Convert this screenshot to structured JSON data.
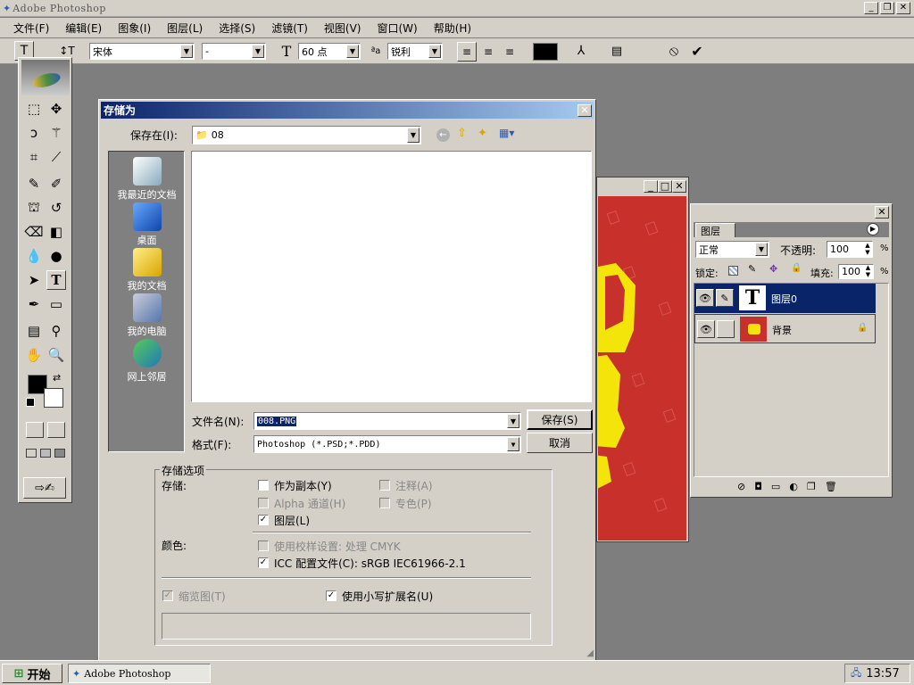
{
  "app": {
    "title": "Adobe Photoshop"
  },
  "menubar": [
    "文件(F)",
    "编辑(E)",
    "图象(I)",
    "图层(L)",
    "选择(S)",
    "滤镜(T)",
    "视图(V)",
    "窗口(W)",
    "帮助(H)"
  ],
  "options": {
    "font_family": "宋体",
    "font_style": "-",
    "font_size": "60 点",
    "antialias": "锐利",
    "color": "#000000"
  },
  "dialog": {
    "title": "存储为",
    "save_in_label": "保存在(I):",
    "save_in_value": "08",
    "places": [
      "我最近的文档",
      "桌面",
      "我的文档",
      "我的电脑",
      "网上邻居"
    ],
    "filename_label": "文件名(N):",
    "filename_value": "008.PNG",
    "format_label": "格式(F):",
    "format_value": "Photoshop (*.PSD;*.PDD)",
    "save_button": "保存(S)",
    "cancel_button": "取消",
    "options_group": "存储选项",
    "save_label": "存储:",
    "as_copy": "作为副本(Y)",
    "annotations": "注释(A)",
    "alpha": "Alpha 通道(H)",
    "spot": "专色(P)",
    "layers": "图层(L)",
    "color_label": "颜色:",
    "proof": "使用校样设置: 处理 CMYK",
    "icc": "ICC 配置文件(C): sRGB IEC61966-2.1",
    "thumbnail": "缩览图(T)",
    "lowercase": "使用小写扩展名(U)"
  },
  "layers_panel": {
    "tab": "图层",
    "blend_mode": "正常",
    "opacity_label": "不透明:",
    "opacity_value": "100",
    "percent": "%",
    "lock_label": "锁定:",
    "fill_label": "填充:",
    "fill_value": "100",
    "layers": [
      {
        "name": "图层0",
        "selected": true
      },
      {
        "name": "背景",
        "selected": false
      }
    ]
  },
  "taskbar": {
    "start": "开始",
    "task": "Adobe Photoshop",
    "time": "13:57"
  }
}
